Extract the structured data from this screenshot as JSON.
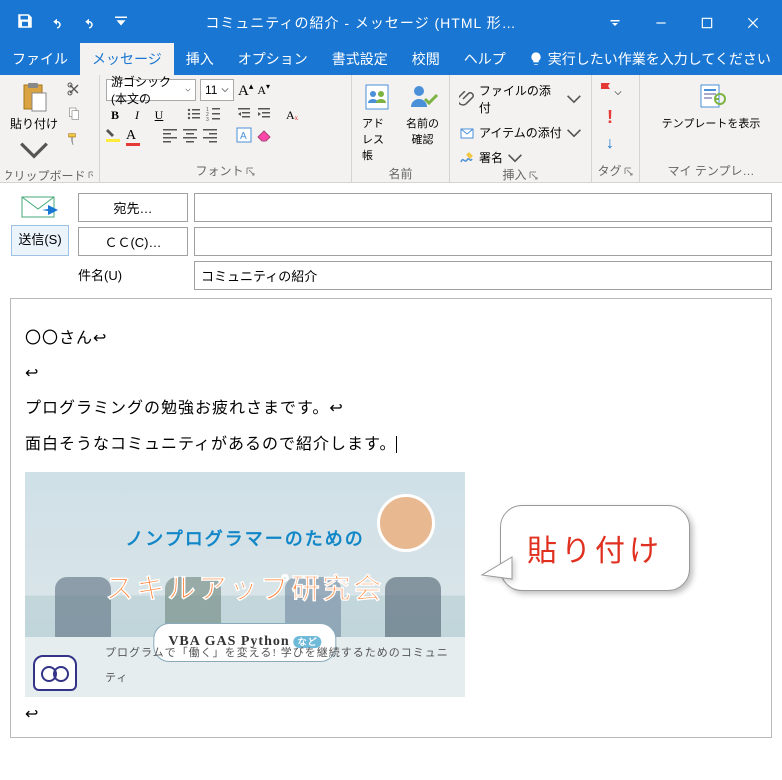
{
  "titlebar": {
    "title": "コミュニティの紹介 - メッセージ (HTML 形…"
  },
  "tabs": {
    "file": "ファイル",
    "message": "メッセージ",
    "insert": "挿入",
    "options": "オプション",
    "format": "書式設定",
    "review": "校閲",
    "help": "ヘルプ",
    "search": "実行したい作業を入力してください"
  },
  "ribbon": {
    "clipboard": {
      "label": "クリップボード",
      "paste": "貼り付け"
    },
    "font": {
      "label": "フォント",
      "name": "游ゴシック (本文の",
      "size": "11"
    },
    "name": {
      "label": "名前",
      "addressbook": "アドレス帳",
      "checknames": "名前の\n確認"
    },
    "insert": {
      "label": "挿入",
      "attach_file": "ファイルの添付",
      "attach_item": "アイテムの添付",
      "signature": "署名"
    },
    "tag": {
      "label": "タグ"
    },
    "template": {
      "label": "マイ テンプレ…",
      "show": "テンプレートを表示"
    }
  },
  "compose": {
    "send": "送信(S)",
    "to": "宛先…",
    "cc": "ＣＣ(C)…",
    "subject_label": "件名(U)",
    "subject_value": "コミュニティの紹介"
  },
  "body": {
    "line1": "〇〇さん",
    "line2": "プログラミングの勉強お疲れさまです。",
    "line3": "面白そうなコミュニティがあるので紹介します。"
  },
  "pasted": {
    "line1": "ノンプログラマーのための",
    "line2": "スキルアップ研究会",
    "tag": "VBA GAS Python",
    "tag_etc": "など",
    "sub": "プログラムで「働く」を変える! 学びを継続するためのコミュニティ"
  },
  "callout": {
    "text": "貼り付け"
  }
}
